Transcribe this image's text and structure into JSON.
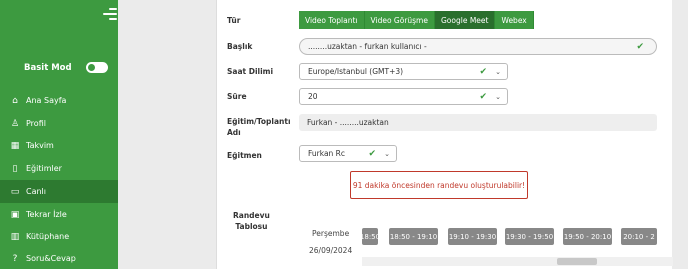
{
  "sidebar": {
    "basic_mode_label": "Basit Mod",
    "items": [
      {
        "label": "Ana Sayfa",
        "icon": "home-icon"
      },
      {
        "label": "Profil",
        "icon": "user-icon"
      },
      {
        "label": "Takvim",
        "icon": "calendar-icon"
      },
      {
        "label": "Eğitimler",
        "icon": "book-icon"
      },
      {
        "label": "Canlı",
        "icon": "video-icon"
      },
      {
        "label": "Tekrar İzle",
        "icon": "replay-icon"
      },
      {
        "label": "Kütüphane",
        "icon": "library-icon"
      },
      {
        "label": "Soru&Cevap",
        "icon": "question-icon"
      }
    ],
    "active_item": "Canlı"
  },
  "form": {
    "type_label": "Tür",
    "tabs": [
      "Video Toplantı",
      "Video Görüşme",
      "Google Meet",
      "Webex"
    ],
    "active_tab": "Google Meet",
    "title_label": "Başlık",
    "title_value": "........uzaktan - furkan  kullanıcı -",
    "timezone_label": "Saat Dilimi",
    "timezone_value": "Europe/Istanbul (GMT+3)",
    "duration_label": "Süre",
    "duration_value": "20",
    "training_label": "Eğitim/Toplantı Adı",
    "training_value": "Furkan - ........uzaktan",
    "instructor_label": "Eğitmen",
    "instructor_value": "Furkan Rc"
  },
  "alert_text": "91 dakika öncesinden randevu oluşturulabilir!",
  "schedule": {
    "label_line1": "Randevu",
    "label_line2": "Tablosu",
    "day_name": "Perşembe",
    "day_date": "26/09/2024",
    "slots": [
      "18:50",
      "18:50 - 19:10",
      "19:10 - 19:30",
      "19:30 - 19:50",
      "19:50 - 20:10",
      "20:10 - 2"
    ]
  },
  "colors": {
    "primary": "#3d9a40",
    "active": "#2a6f2d",
    "alert": "#c0392b",
    "slot": "#888888"
  }
}
